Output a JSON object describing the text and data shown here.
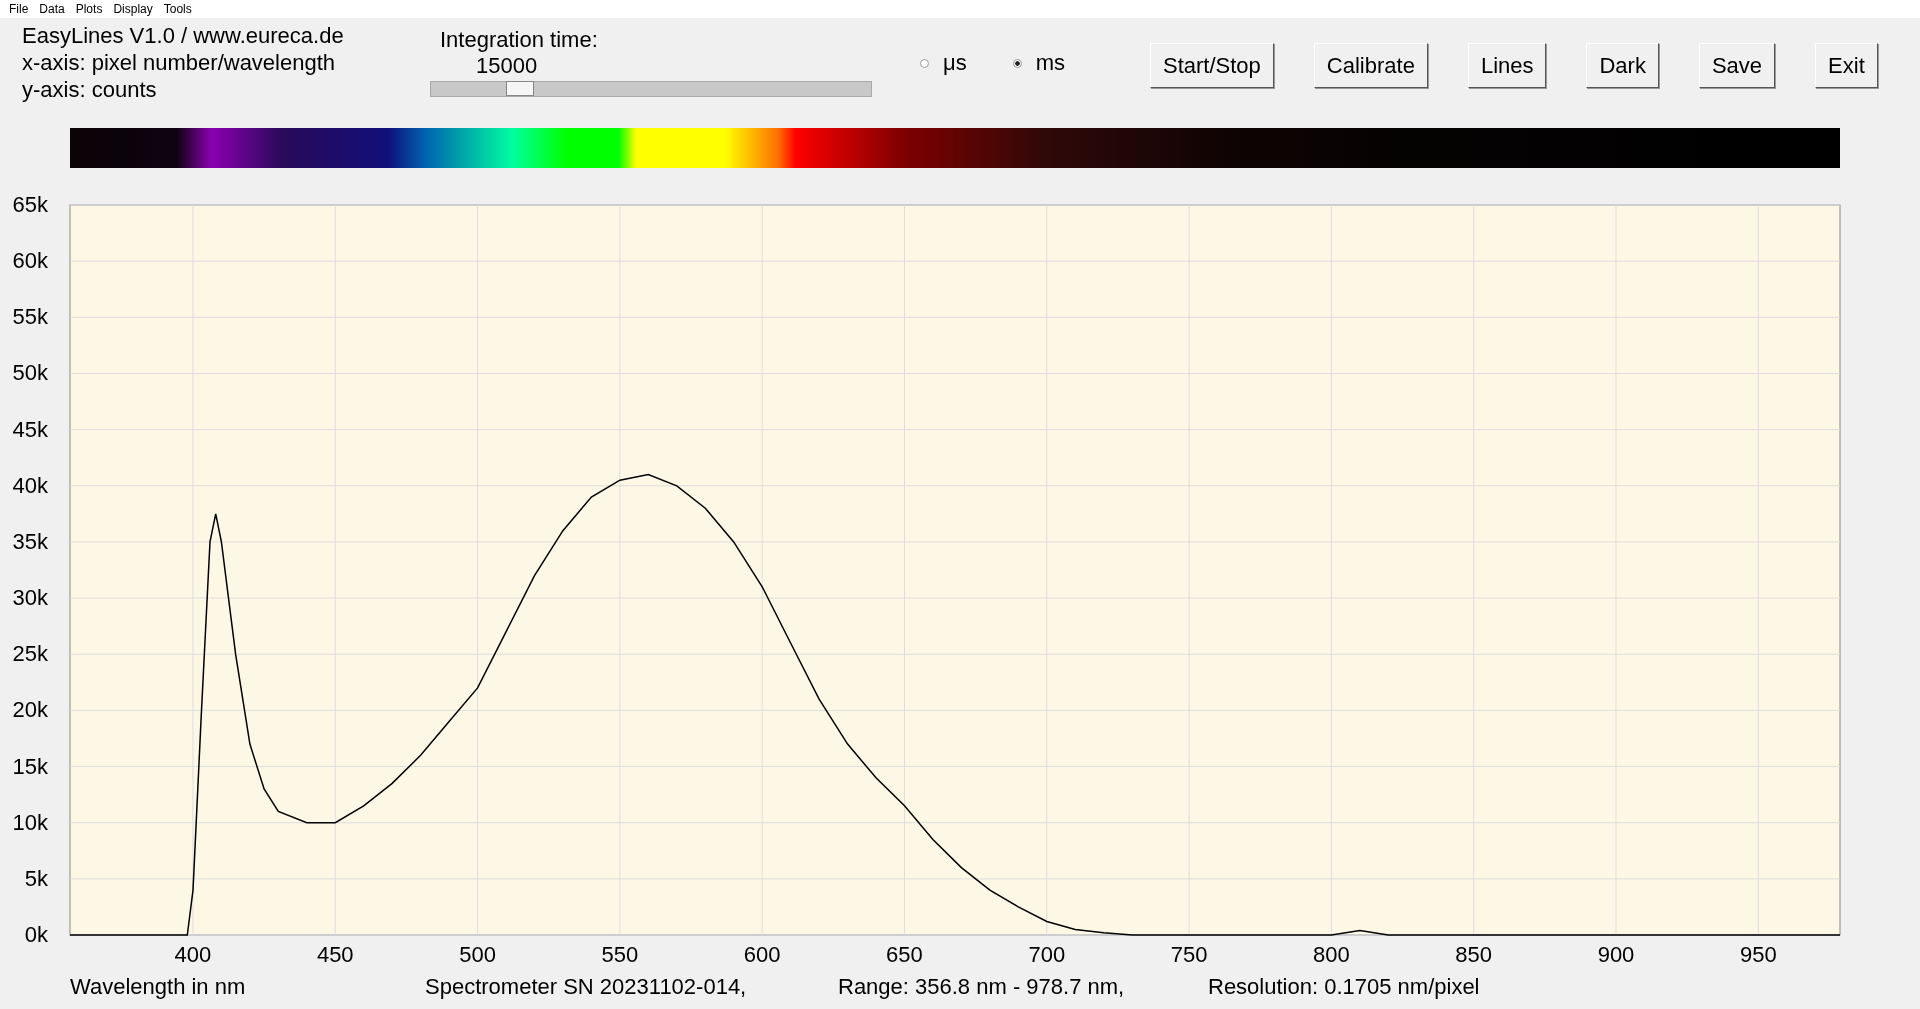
{
  "menu": [
    "File",
    "Data",
    "Plots",
    "Display",
    "Tools"
  ],
  "info": [
    "EasyLines V1.0 / www.eureca.de",
    "x-axis: pixel number/wavelength",
    "y-axis: counts"
  ],
  "integration": {
    "label": "Integration time:",
    "value": "15000",
    "level": 0.17
  },
  "units": [
    {
      "label": "μs",
      "selected": false
    },
    {
      "label": "ms",
      "selected": true
    }
  ],
  "buttons": [
    "Start/Stop",
    "Calibrate",
    "Lines",
    "Dark",
    "Save",
    "Exit"
  ],
  "chart_data": {
    "type": "line",
    "xlim": [
      356.8,
      978.7
    ],
    "ylim": [
      0,
      65000
    ],
    "xticks": [
      400,
      450,
      500,
      550,
      600,
      650,
      700,
      750,
      800,
      850,
      900,
      950
    ],
    "yticks": [
      {
        "value": 0,
        "label": "0k"
      },
      {
        "value": 5000,
        "label": "5k"
      },
      {
        "value": 10000,
        "label": "10k"
      },
      {
        "value": 15000,
        "label": "15k"
      },
      {
        "value": 20000,
        "label": "20k"
      },
      {
        "value": 25000,
        "label": "25k"
      },
      {
        "value": 30000,
        "label": "30k"
      },
      {
        "value": 35000,
        "label": "35k"
      },
      {
        "value": 40000,
        "label": "40k"
      },
      {
        "value": 45000,
        "label": "45k"
      },
      {
        "value": 50000,
        "label": "50k"
      },
      {
        "value": 55000,
        "label": "55k"
      },
      {
        "value": 60000,
        "label": "60k"
      },
      {
        "value": 65000,
        "label": "65k"
      }
    ],
    "x": [
      356.8,
      380,
      395,
      398,
      400,
      403,
      406,
      408,
      410,
      415,
      420,
      425,
      430,
      440,
      450,
      460,
      470,
      480,
      490,
      500,
      510,
      520,
      530,
      540,
      550,
      560,
      570,
      580,
      590,
      600,
      610,
      620,
      630,
      640,
      650,
      660,
      670,
      680,
      690,
      700,
      710,
      720,
      730,
      800,
      810,
      820,
      900,
      978.7
    ],
    "grid": true,
    "series": [
      {
        "color": "#000000",
        "values": [
          0,
          0,
          0,
          0,
          4000,
          20000,
          35000,
          37500,
          35000,
          25000,
          17000,
          13000,
          11000,
          10000,
          10000,
          11500,
          13500,
          16000,
          19000,
          22000,
          27000,
          32000,
          36000,
          39000,
          40500,
          41000,
          40000,
          38000,
          35000,
          31000,
          26000,
          21000,
          17000,
          14000,
          11500,
          8500,
          6000,
          4000,
          2500,
          1200,
          500,
          200,
          0,
          0,
          400,
          0,
          0,
          0
        ]
      }
    ]
  },
  "footer": [
    "Wavelength in nm",
    "Spectrometer SN 20231102-014,",
    "Range: 356.8 nm - 978.7 nm,",
    "Resolution: 0.1705 nm/pixel"
  ]
}
